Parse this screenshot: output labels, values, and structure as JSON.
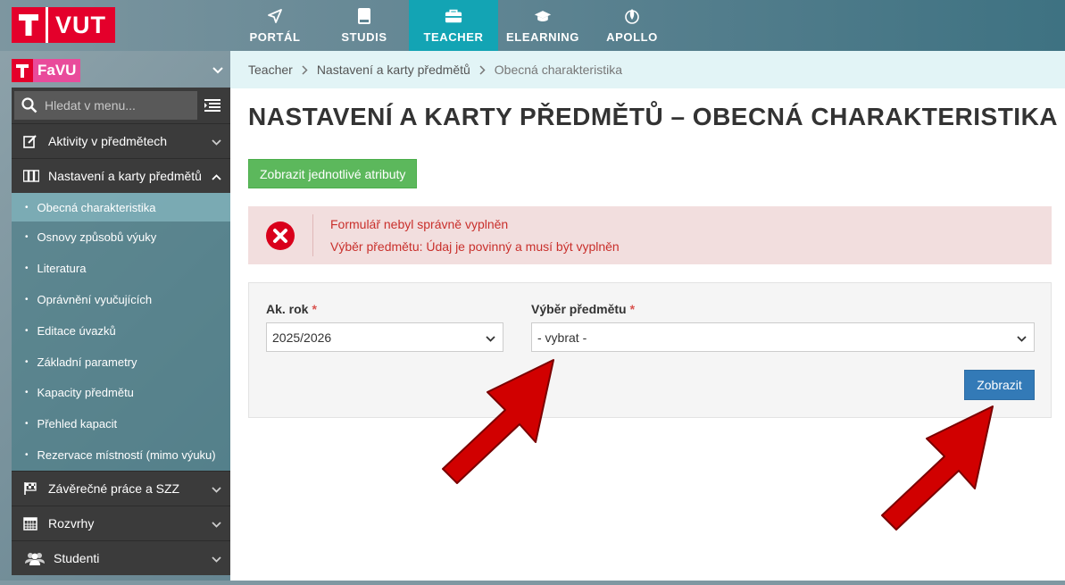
{
  "header": {
    "logo_text": "VUT",
    "nav": [
      {
        "label": "PORTÁL",
        "icon": "paper-plane-icon"
      },
      {
        "label": "STUDIS",
        "icon": "book-icon"
      },
      {
        "label": "TEACHER",
        "icon": "briefcase-icon",
        "active": true
      },
      {
        "label": "ELEARNING",
        "icon": "graduation-cap-icon"
      },
      {
        "label": "APOLLO",
        "icon": "rocket-icon"
      }
    ]
  },
  "sidebar": {
    "faculty": "FaVU",
    "search_placeholder": "Hledat v menu...",
    "sections_top": [
      {
        "label": "Aktivity v předmětech",
        "icon": "edit-icon",
        "expanded": false
      },
      {
        "label": "Nastavení a karty předmětů",
        "icon": "columns-icon",
        "expanded": true
      }
    ],
    "sub_items": [
      {
        "label": "Obecná charakteristika",
        "active": true
      },
      {
        "label": "Osnovy způsobů výuky"
      },
      {
        "label": "Literatura"
      },
      {
        "label": "Oprávnění vyučujících"
      },
      {
        "label": "Editace úvazků"
      },
      {
        "label": "Základní parametry"
      },
      {
        "label": "Kapacity předmětu"
      },
      {
        "label": "Přehled kapacit"
      },
      {
        "label": "Rezervace místností (mimo výuku)"
      }
    ],
    "sections_bottom": [
      {
        "label": "Závěrečné práce a SZZ",
        "icon": "flag-icon"
      },
      {
        "label": "Rozvrhy",
        "icon": "calendar-icon"
      },
      {
        "label": "Studenti",
        "icon": "users-icon"
      }
    ]
  },
  "breadcrumb": [
    "Teacher",
    "Nastavení a karty předmětů",
    "Obecná charakteristika"
  ],
  "page_title": "NASTAVENÍ A KARTY PŘEDMĚTŮ – OBECNÁ CHARAKTERISTIKA",
  "show_attributes_button": "Zobrazit jednotlivé atributy",
  "alert": {
    "line1": "Formulář nebyl správně vyplněn",
    "line2": "Výběr předmětu: Údaj je povinný a musí být vyplněn"
  },
  "form": {
    "year_label": "Ak. rok",
    "year_value": "2025/2026",
    "subject_label": "Výběr předmětu",
    "subject_value": "- vybrat -",
    "required_mark": "*",
    "submit_label": "Zobrazit"
  },
  "colors": {
    "brand_red": "#e4002b",
    "active_nav": "#13a4b4",
    "annotation_arrow": "#d10000"
  }
}
